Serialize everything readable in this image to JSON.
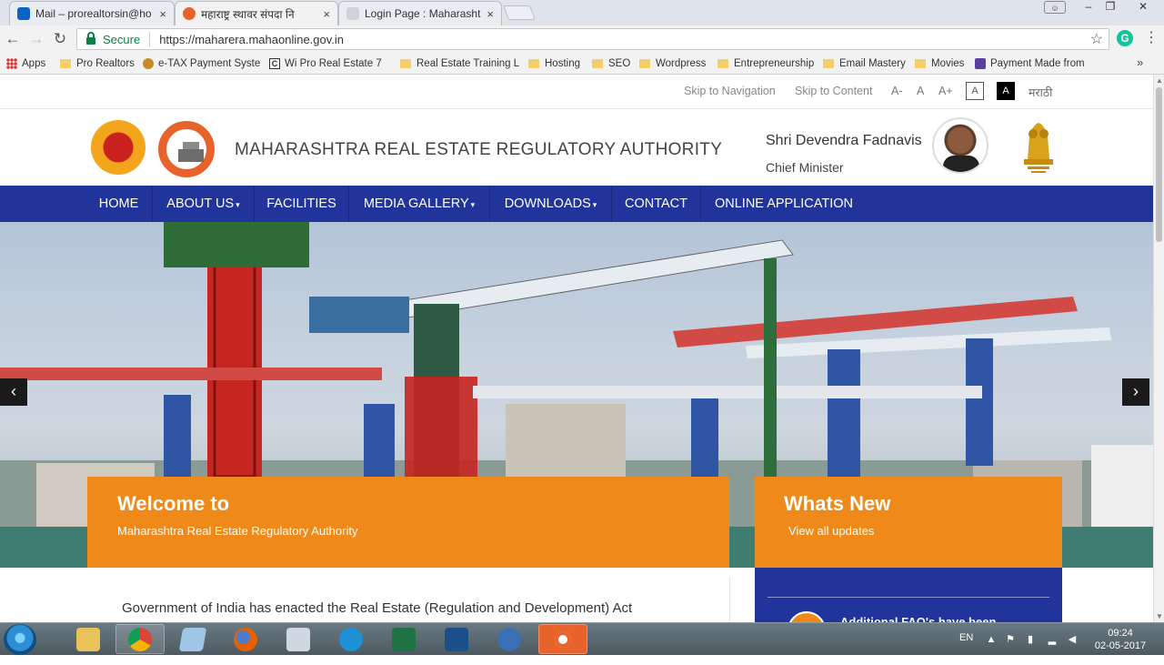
{
  "browser": {
    "tabs": [
      {
        "label": "Mail – prorealtorsin@ho",
        "close": "×"
      },
      {
        "label": "महाराष्ट्र स्थावर संपदा नि",
        "close": "×"
      },
      {
        "label": "Login Page : Maharashtr",
        "close": "×"
      }
    ],
    "security_label": "Secure",
    "url": "https://maharera.mahaonline.gov.in",
    "extension_label": "G",
    "bookmarks": [
      {
        "label": "Apps"
      },
      {
        "label": "Pro Realtors"
      },
      {
        "label": "e-TAX Payment Syste"
      },
      {
        "label": "Wi  Pro Real Estate 7"
      },
      {
        "label": "Real Estate Training L"
      },
      {
        "label": "Hosting"
      },
      {
        "label": "SEO"
      },
      {
        "label": "Wordpress"
      },
      {
        "label": "Entrepreneurship"
      },
      {
        "label": "Email Mastery"
      },
      {
        "label": "Movies"
      },
      {
        "label": "Payment Made from"
      }
    ],
    "bookmarks_more": "»"
  },
  "site": {
    "accessibility": {
      "skip_navigation": "Skip to Navigation",
      "skip_content": "Skip to Content",
      "font_decrease": "A-",
      "font_normal": "A",
      "font_increase": "A+",
      "contrast_white": "A",
      "contrast_black": "A",
      "language": "मराठी"
    },
    "org_title": "MAHARASHTRA REAL ESTATE REGULATORY AUTHORITY",
    "cm_name": "Shri Devendra Fadnavis",
    "cm_role": "Chief Minister",
    "nav": [
      {
        "label": "HOME",
        "caret": ""
      },
      {
        "label": "ABOUT US",
        "caret": "▾"
      },
      {
        "label": "FACILITIES",
        "caret": ""
      },
      {
        "label": "MEDIA GALLERY",
        "caret": "▾"
      },
      {
        "label": "DOWNLOADS",
        "caret": "▾"
      },
      {
        "label": "CONTACT",
        "caret": ""
      },
      {
        "label": "ONLINE APPLICATION",
        "caret": ""
      }
    ],
    "carousel": {
      "prev": "‹",
      "next": "›"
    },
    "welcome": {
      "heading": "Welcome to",
      "subheading": "Maharashtra Real Estate Regulatory Authority"
    },
    "whats_new": {
      "heading": "Whats New",
      "link": "View all updates",
      "first_item": "Additional FAQ's have been"
    },
    "intro_text": "Government of India has enacted the Real Estate (Regulation and Development) Act"
  },
  "taskbar": {
    "language": "EN",
    "time": "09:24",
    "date": "02-05-2017"
  },
  "colors": {
    "nav_blue": "#20349b",
    "accent_orange": "#ef8a1a"
  }
}
